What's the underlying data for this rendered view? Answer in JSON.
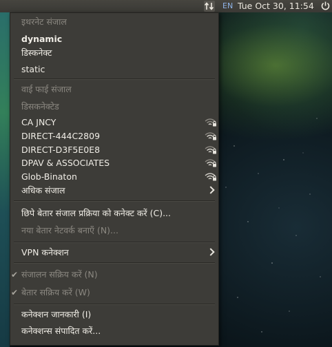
{
  "panel": {
    "language": "EN",
    "clock": "Tue Oct 30, 11:54"
  },
  "menu": {
    "ethernet_header": "इथरनेट संजाल",
    "dynamic": "dynamic",
    "disconnect": "डिस्कनेक्ट",
    "static": "static",
    "wifi_header": "वाई फाई  संजाल",
    "wifi_status": "डिसकनेक्टेड",
    "networks": [
      {
        "name": "CA JNCY"
      },
      {
        "name": "DIRECT-444C2809"
      },
      {
        "name": "DIRECT-D3F5E0E8"
      },
      {
        "name": "DPAV & ASSOCIATES"
      },
      {
        "name": "Glob-Binaton"
      }
    ],
    "more_networks": "अधिक संजाल",
    "connect_hidden": "छिपे बेतार संजाल प्रक्रिया को कनेक्ट करें (C)...",
    "new_wireless": "नया बेतार नेटवर्क बनाएँ (N)...",
    "vpn": "VPN कनेक्शन",
    "enable_networking": "संजालन सक्रिय करें (N)",
    "enable_wireless": "बेतार सक्रिय करें (W)",
    "connection_info": "कनेक्शन जानकारी (I)",
    "edit_connections": "कनेक्शन्स संपादित करें..."
  }
}
